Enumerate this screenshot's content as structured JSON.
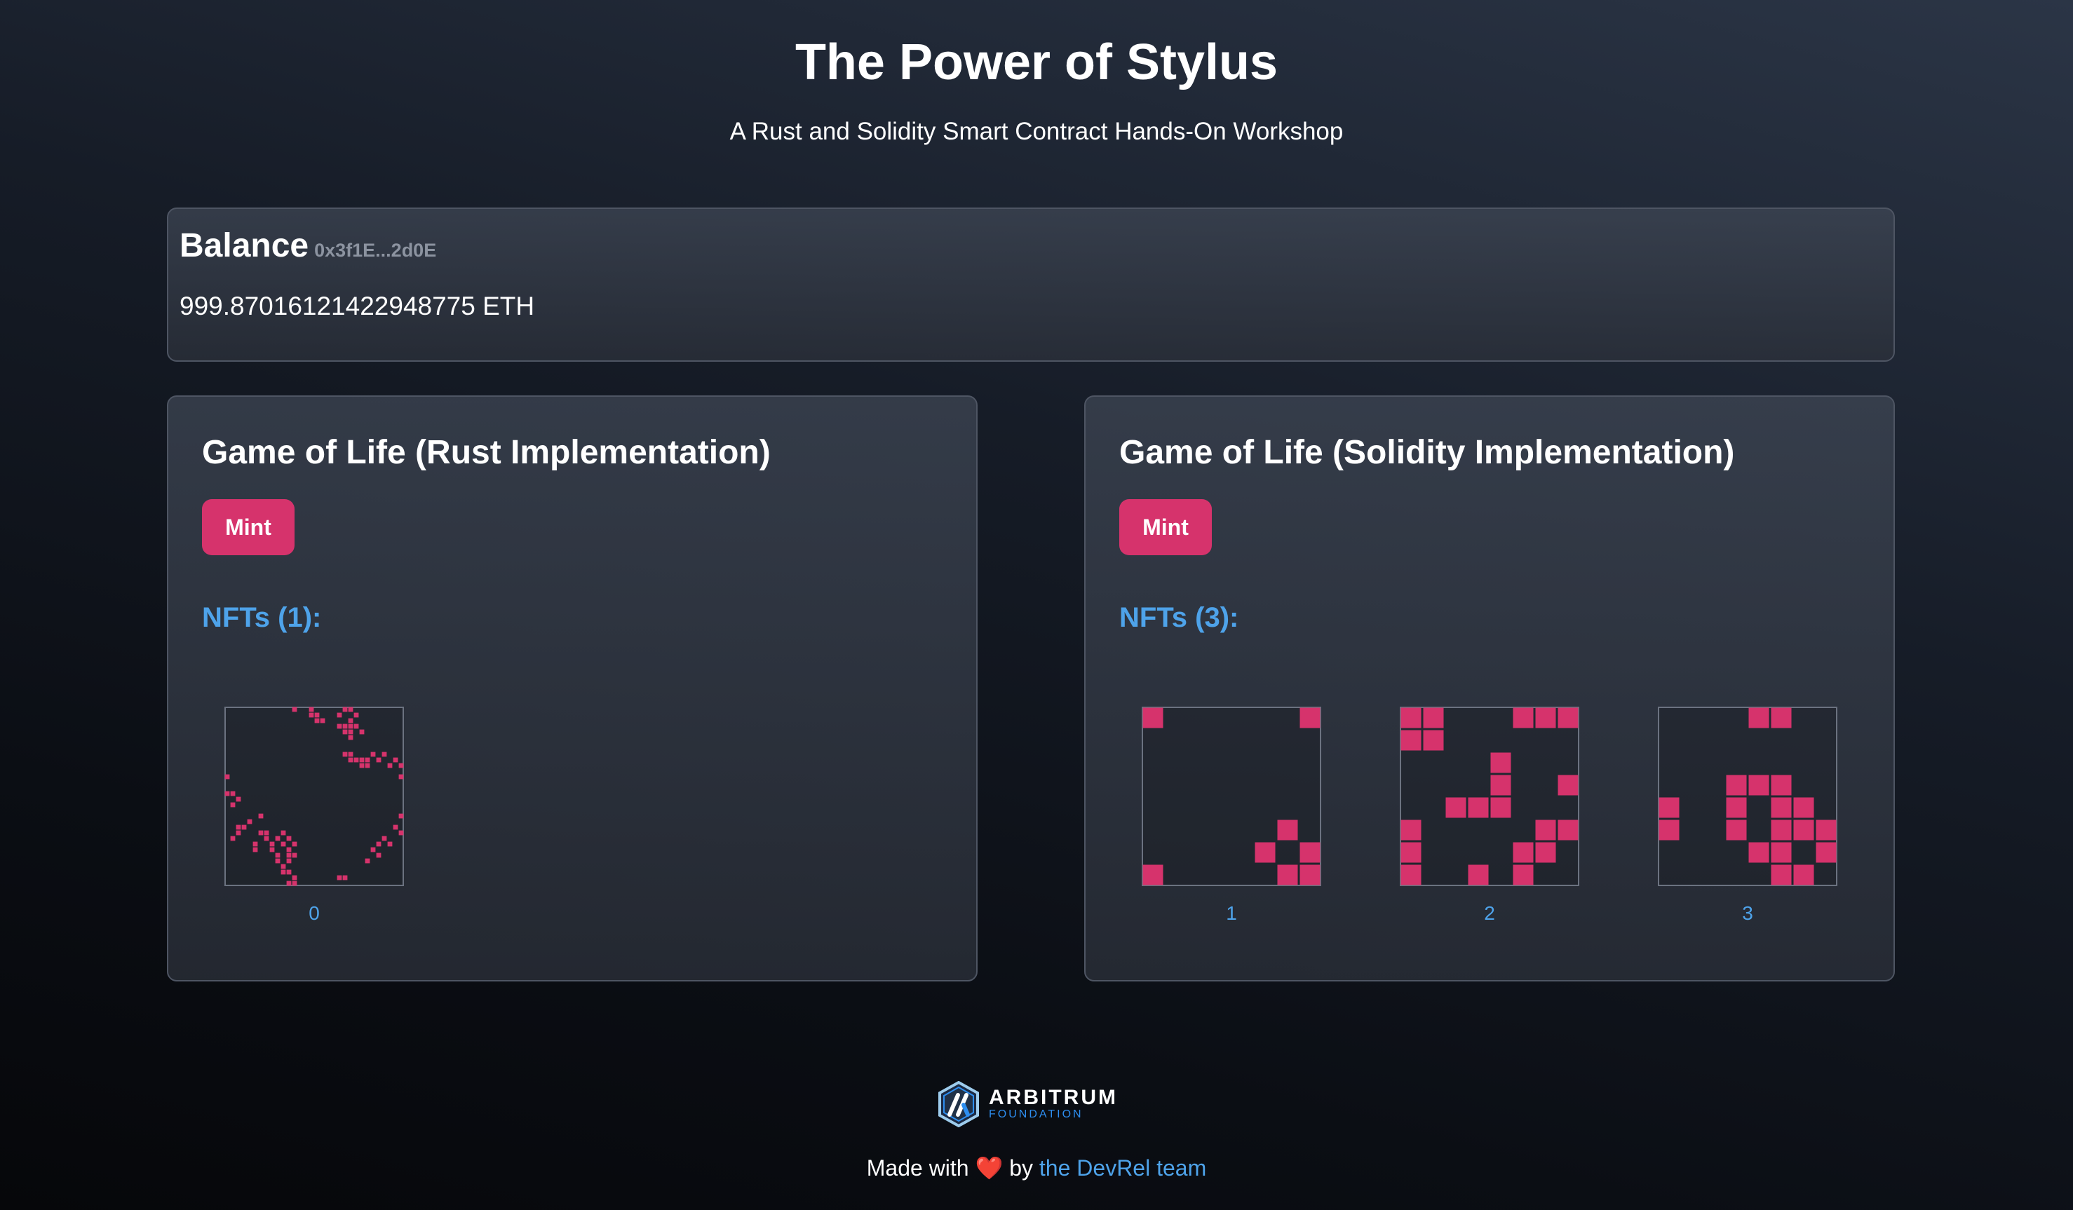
{
  "header": {
    "title": "The Power of Stylus",
    "subtitle": "A Rust and Solidity Smart Contract Hands-On Workshop"
  },
  "balance": {
    "title": "Balance",
    "address": "0x3f1E...2d0E",
    "value": "999.87016121422948775 ETH"
  },
  "games": [
    {
      "title": "Game of Life (Rust Implementation)",
      "mint_label": "Mint",
      "nfts_label": "NFTs (1):",
      "nfts": [
        {
          "id": "0",
          "grid_size": 32,
          "cells": [
            [
              12,
              0
            ],
            [
              15,
              0
            ],
            [
              21,
              0
            ],
            [
              22,
              0
            ],
            [
              15,
              1
            ],
            [
              16,
              1
            ],
            [
              20,
              1
            ],
            [
              23,
              1
            ],
            [
              16,
              2
            ],
            [
              17,
              2
            ],
            [
              22,
              2
            ],
            [
              20,
              3
            ],
            [
              21,
              3
            ],
            [
              22,
              3
            ],
            [
              23,
              3
            ],
            [
              21,
              4
            ],
            [
              22,
              4
            ],
            [
              24,
              4
            ],
            [
              22,
              5
            ],
            [
              21,
              8
            ],
            [
              22,
              8
            ],
            [
              26,
              8
            ],
            [
              28,
              8
            ],
            [
              22,
              9
            ],
            [
              23,
              9
            ],
            [
              24,
              9
            ],
            [
              25,
              9
            ],
            [
              27,
              9
            ],
            [
              30,
              9
            ],
            [
              24,
              10
            ],
            [
              25,
              10
            ],
            [
              29,
              10
            ],
            [
              31,
              10
            ],
            [
              0,
              12
            ],
            [
              31,
              12
            ],
            [
              0,
              15
            ],
            [
              1,
              15
            ],
            [
              2,
              16
            ],
            [
              1,
              17
            ],
            [
              6,
              19
            ],
            [
              31,
              19
            ],
            [
              4,
              20
            ],
            [
              2,
              21
            ],
            [
              3,
              21
            ],
            [
              30,
              21
            ],
            [
              2,
              22
            ],
            [
              6,
              22
            ],
            [
              7,
              22
            ],
            [
              10,
              22
            ],
            [
              31,
              22
            ],
            [
              1,
              23
            ],
            [
              7,
              23
            ],
            [
              9,
              23
            ],
            [
              11,
              23
            ],
            [
              28,
              23
            ],
            [
              5,
              24
            ],
            [
              8,
              24
            ],
            [
              10,
              24
            ],
            [
              12,
              24
            ],
            [
              27,
              24
            ],
            [
              29,
              24
            ],
            [
              5,
              25
            ],
            [
              8,
              25
            ],
            [
              11,
              25
            ],
            [
              26,
              25
            ],
            [
              9,
              26
            ],
            [
              11,
              26
            ],
            [
              12,
              26
            ],
            [
              27,
              26
            ],
            [
              9,
              27
            ],
            [
              11,
              27
            ],
            [
              25,
              27
            ],
            [
              10,
              28
            ],
            [
              10,
              29
            ],
            [
              11,
              29
            ],
            [
              12,
              30
            ],
            [
              20,
              30
            ],
            [
              21,
              30
            ],
            [
              11,
              31
            ],
            [
              12,
              31
            ]
          ]
        }
      ]
    },
    {
      "title": "Game of Life (Solidity Implementation)",
      "mint_label": "Mint",
      "nfts_label": "NFTs (3):",
      "nfts": [
        {
          "id": "1",
          "grid_size": 8,
          "cells": [
            [
              0,
              0
            ],
            [
              7,
              0
            ],
            [
              6,
              5
            ],
            [
              5,
              6
            ],
            [
              7,
              6
            ],
            [
              0,
              7
            ],
            [
              6,
              7
            ],
            [
              7,
              7
            ]
          ]
        },
        {
          "id": "2",
          "grid_size": 8,
          "cells": [
            [
              0,
              0
            ],
            [
              1,
              0
            ],
            [
              5,
              0
            ],
            [
              6,
              0
            ],
            [
              7,
              0
            ],
            [
              0,
              1
            ],
            [
              1,
              1
            ],
            [
              4,
              2
            ],
            [
              4,
              3
            ],
            [
              7,
              3
            ],
            [
              2,
              4
            ],
            [
              3,
              4
            ],
            [
              4,
              4
            ],
            [
              0,
              5
            ],
            [
              6,
              5
            ],
            [
              7,
              5
            ],
            [
              0,
              6
            ],
            [
              5,
              6
            ],
            [
              6,
              6
            ],
            [
              0,
              7
            ],
            [
              3,
              7
            ],
            [
              5,
              7
            ]
          ]
        },
        {
          "id": "3",
          "grid_size": 8,
          "cells": [
            [
              4,
              0
            ],
            [
              5,
              0
            ],
            [
              3,
              3
            ],
            [
              4,
              3
            ],
            [
              5,
              3
            ],
            [
              0,
              4
            ],
            [
              3,
              4
            ],
            [
              5,
              4
            ],
            [
              6,
              4
            ],
            [
              0,
              5
            ],
            [
              3,
              5
            ],
            [
              5,
              5
            ],
            [
              6,
              5
            ],
            [
              7,
              5
            ],
            [
              4,
              6
            ],
            [
              5,
              6
            ],
            [
              7,
              6
            ],
            [
              5,
              7
            ],
            [
              6,
              7
            ]
          ]
        }
      ]
    }
  ],
  "footer": {
    "logo_main": "ARBITRUM",
    "logo_sub": "FOUNDATION",
    "made_prefix": "Made with",
    "heart": "❤️",
    "by": "by",
    "link_text": "the DevRel team"
  },
  "colors": {
    "accent": "#d6336c",
    "link": "#4ea3ea",
    "cell": "#d6336c"
  }
}
